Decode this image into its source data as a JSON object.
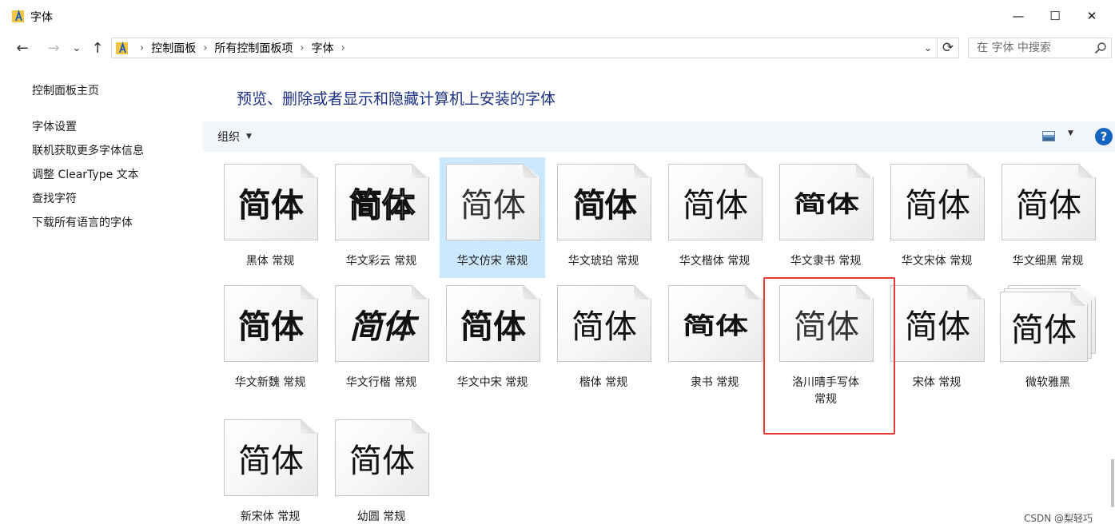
{
  "window": {
    "title": "字体",
    "minimize_glyph": "—",
    "maximize_glyph": "☐",
    "close_glyph": "✕",
    "icon": "fonts-folder-icon"
  },
  "nav": {
    "back_glyph": "←",
    "forward_glyph": "→",
    "recent_glyph": "⌄",
    "up_glyph": "↑",
    "breadcrumb": [
      "控制面板",
      "所有控制面板项",
      "字体"
    ],
    "breadcrumb_sep": "›",
    "address_dropdown_glyph": "⌄",
    "refresh_glyph": "⟳",
    "search_placeholder": "在 字体 中搜索"
  },
  "sidebar": {
    "home": "控制面板主页",
    "items": [
      "字体设置",
      "联机获取更多字体信息",
      "调整 ClearType 文本",
      "查找字符",
      "下载所有语言的字体"
    ]
  },
  "main": {
    "heading": "预览、删除或者显示和隐藏计算机上安装的字体",
    "organize_label": "组织",
    "organize_caret": "▼",
    "view_caret": "▼",
    "help_glyph": "?",
    "sample_text": "简体",
    "fonts": [
      {
        "label": "黑体 常规",
        "selected": false,
        "stack": false
      },
      {
        "label": "华文彩云 常规",
        "selected": false,
        "stack": false
      },
      {
        "label": "华文仿宋 常规",
        "selected": true,
        "stack": false
      },
      {
        "label": "华文琥珀 常规",
        "selected": false,
        "stack": false
      },
      {
        "label": "华文楷体 常规",
        "selected": false,
        "stack": false
      },
      {
        "label": "华文隶书 常规",
        "selected": false,
        "stack": false
      },
      {
        "label": "华文宋体 常规",
        "selected": false,
        "stack": false
      },
      {
        "label": "华文细黑 常规",
        "selected": false,
        "stack": false
      },
      {
        "label": "华文新魏 常规",
        "selected": false,
        "stack": false
      },
      {
        "label": "华文行楷 常规",
        "selected": false,
        "stack": false
      },
      {
        "label": "华文中宋 常规",
        "selected": false,
        "stack": false
      },
      {
        "label": "楷体 常规",
        "selected": false,
        "stack": false
      },
      {
        "label": "隶书 常规",
        "selected": false,
        "stack": false
      },
      {
        "label": "洛川晴手写体 常规",
        "selected": false,
        "stack": false
      },
      {
        "label": "宋体 常规",
        "selected": false,
        "stack": false
      },
      {
        "label": "微软雅黑",
        "selected": false,
        "stack": true
      },
      {
        "label": "新宋体 常规",
        "selected": false,
        "stack": false
      },
      {
        "label": "幼圆 常规",
        "selected": false,
        "stack": false
      }
    ]
  },
  "watermark": "CSDN @梨轻巧",
  "colors": {
    "heading": "#1e3287",
    "selection": "#cce8ff",
    "highlight_box": "#e53935",
    "help_button": "#1565c0"
  }
}
